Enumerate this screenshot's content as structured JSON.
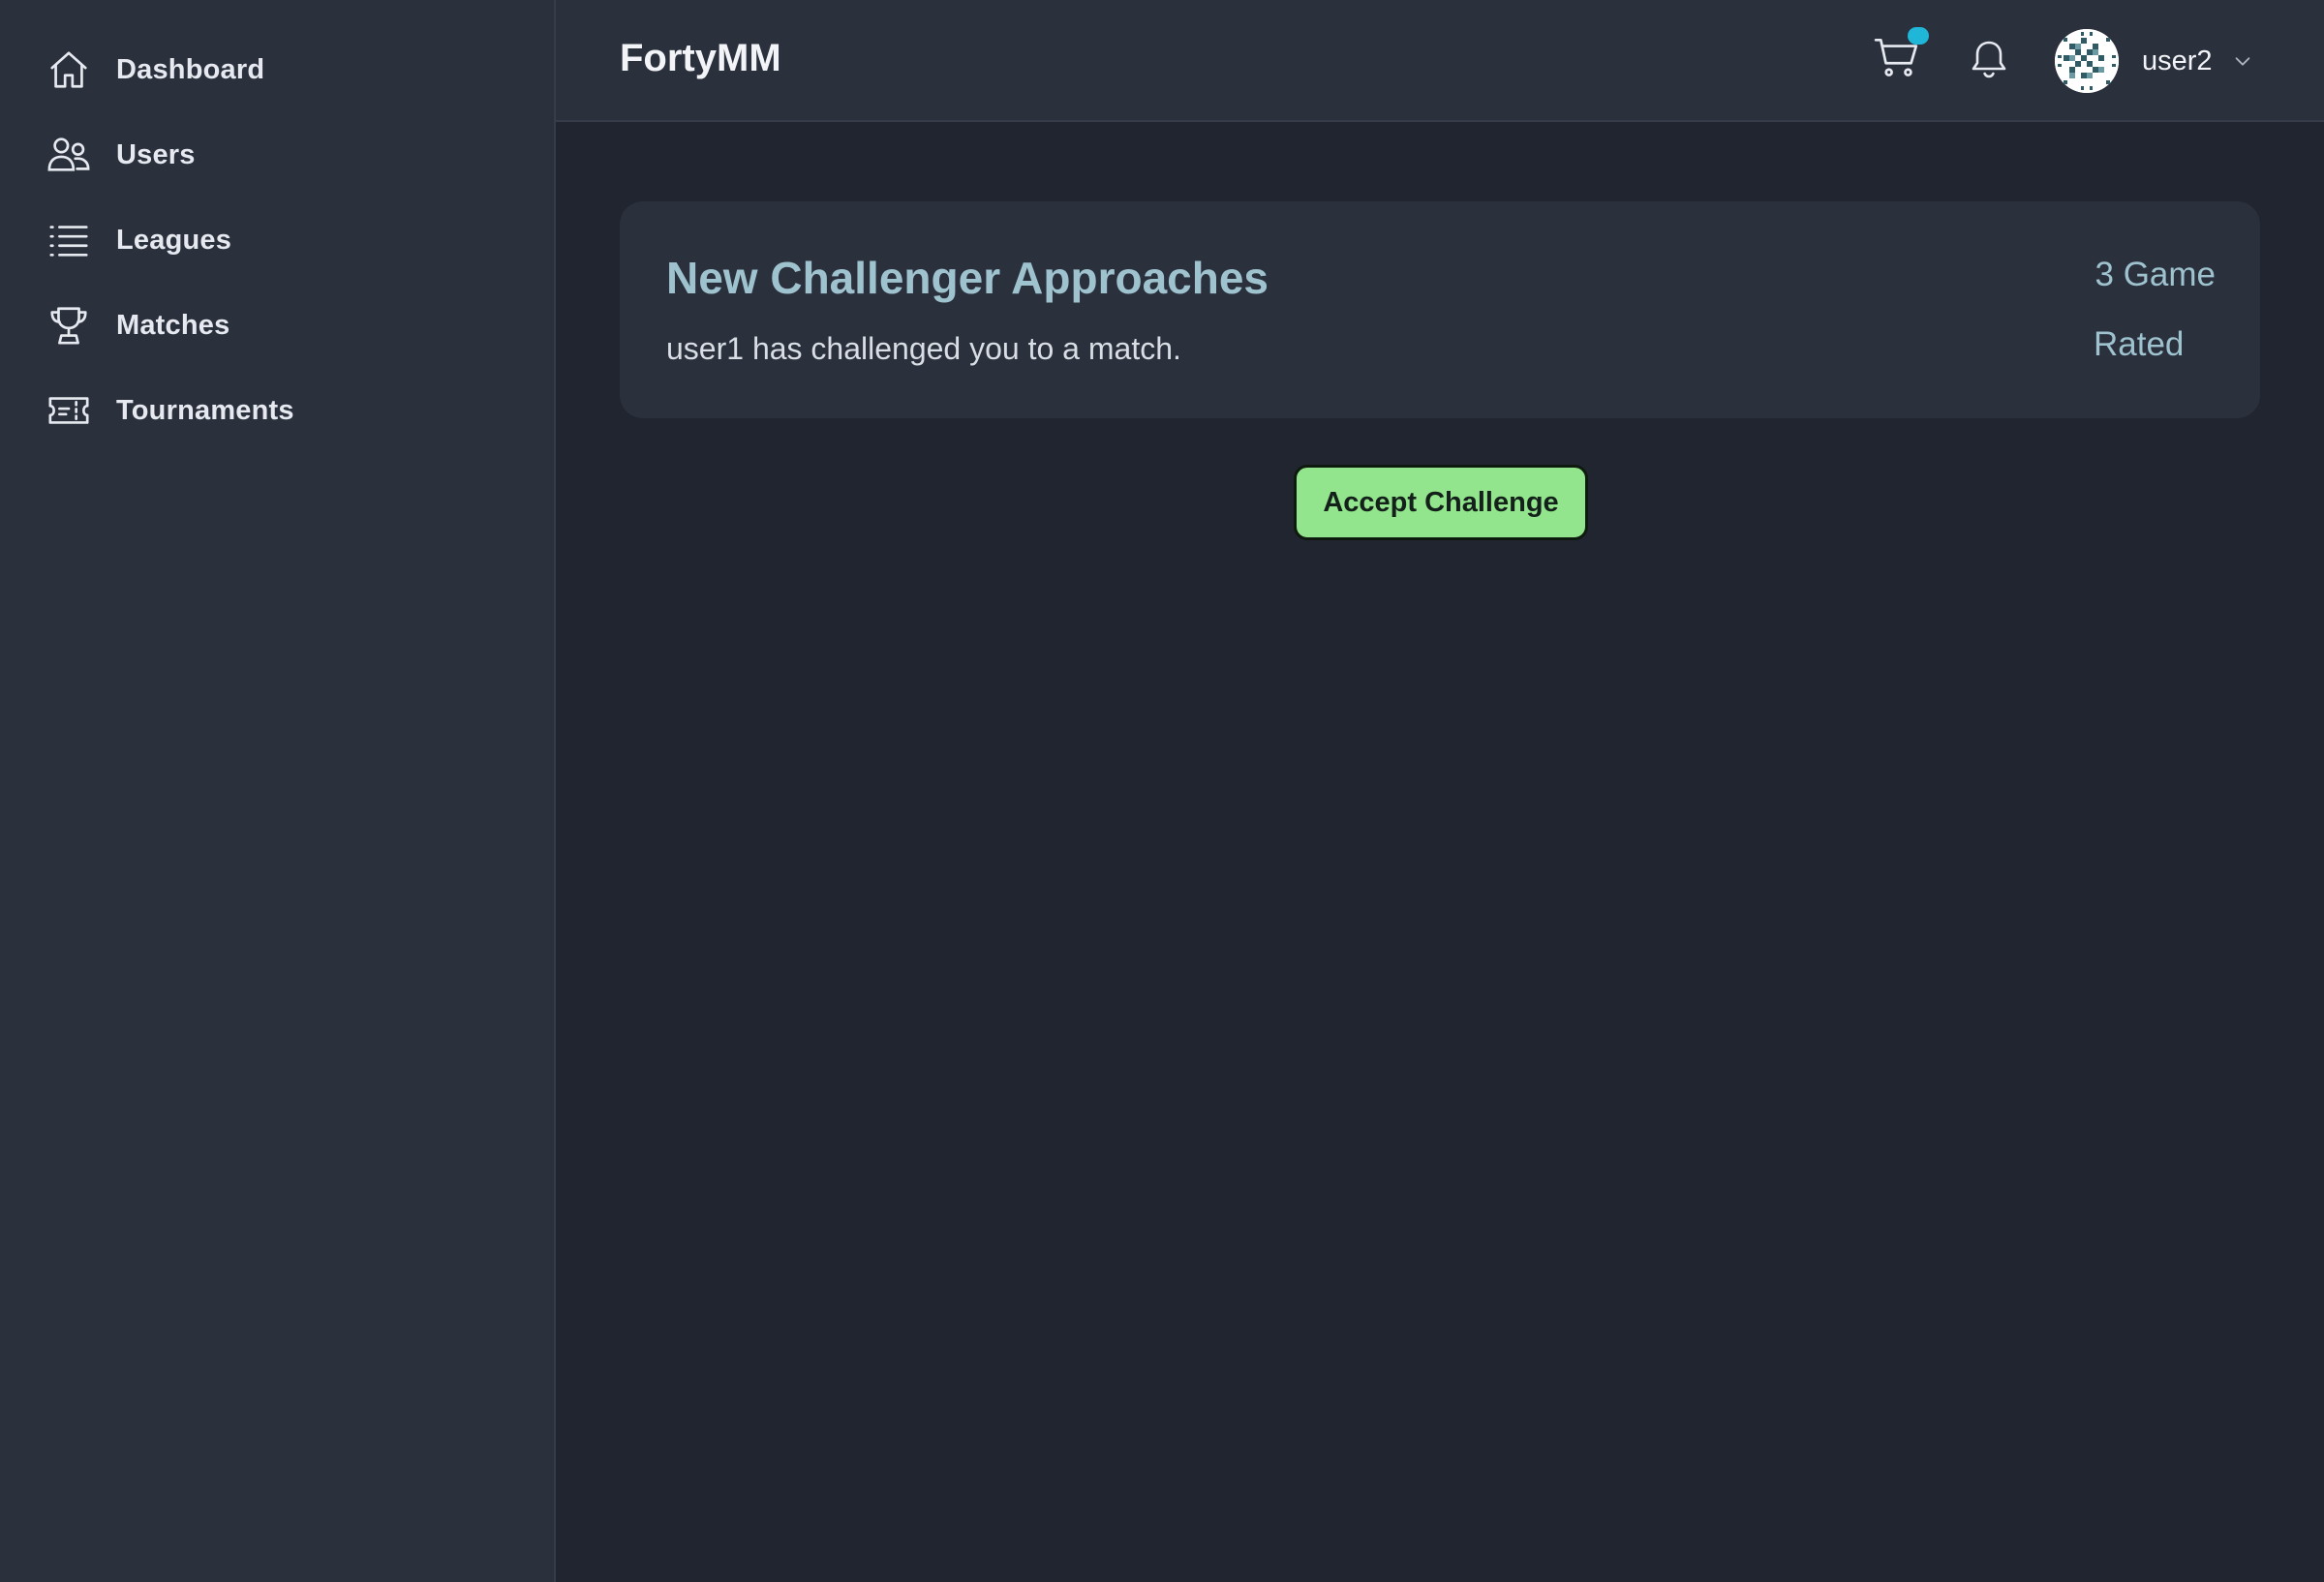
{
  "app": {
    "title": "FortyMM"
  },
  "sidebar": {
    "items": [
      {
        "label": "Dashboard",
        "icon": "home-icon"
      },
      {
        "label": "Users",
        "icon": "users-icon"
      },
      {
        "label": "Leagues",
        "icon": "list-icon"
      },
      {
        "label": "Matches",
        "icon": "trophy-icon"
      },
      {
        "label": "Tournaments",
        "icon": "ticket-icon"
      }
    ]
  },
  "header": {
    "cart_icon": "shopping-cart-icon",
    "bell_icon": "bell-icon",
    "username": "user2",
    "badge_color": "#1fb6d8"
  },
  "challenge": {
    "title": "New Challenger Approaches",
    "message": "user1 has challenged you to a match.",
    "format": "3 Game",
    "rating": "Rated",
    "accept_label": "Accept Challenge"
  },
  "colors": {
    "background": "#212530",
    "panel": "#2b303d",
    "accent_text": "#9fc2cf",
    "accept_button": "#93e58d"
  }
}
